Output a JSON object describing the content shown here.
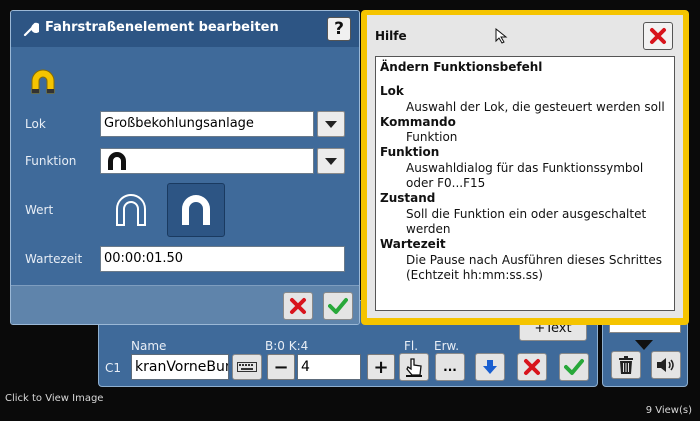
{
  "dialog": {
    "title": "Fahrstraßenelement bearbeiten",
    "help_label": "?",
    "fields": {
      "lok_label": "Lok",
      "lok_value": "Großbekohlungsanlage",
      "funktion_label": "Funktion",
      "wert_label": "Wert",
      "wartezeit_label": "Wartezeit",
      "wartezeit_value": "00:00:01.50"
    }
  },
  "help": {
    "title": "Hilfe",
    "heading": "Ändern Funktionsbefehl",
    "sections": [
      {
        "term": "Lok",
        "desc": "Auswahl der Lok, die gesteuert werden soll"
      },
      {
        "term": "Kommando",
        "desc": "Funktion"
      },
      {
        "term": "Funktion",
        "desc": "Auswahldialog für das Funktionssymbol oder F0...F15"
      },
      {
        "term": "Zustand",
        "desc": "Soll die Funktion ein oder ausgeschaltet werden"
      },
      {
        "term": "Wartezeit",
        "desc": "Die Pause nach Ausführen dieses Schrittes (Echtzeit hh:mm:ss.ss)"
      }
    ]
  },
  "background_editor": {
    "text_button": "+Text",
    "row_label": "C1",
    "name_header": "Name",
    "bk_header": "B:0 K:4",
    "fl_header": "Fl.",
    "erw_header": "Erw.",
    "name_value": "kranVorneBun",
    "minus_label": "−",
    "number_value": "4",
    "plus_label": "+",
    "erw_button": "..."
  },
  "footer": {
    "caption_left": "Click to View Image",
    "views": "9 View(s)"
  },
  "colors": {
    "dialog_bg": "#3f6a9a",
    "header_bg": "#2d5584",
    "help_border": "#f5c400",
    "cancel_red": "#d8141c",
    "ok_green": "#28a83a",
    "magnet_yellow": "#f5c400"
  }
}
